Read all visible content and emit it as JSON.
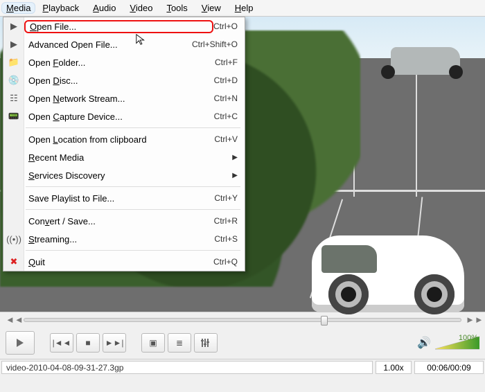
{
  "menubar": {
    "items": [
      "Media",
      "Playback",
      "Audio",
      "Video",
      "Tools",
      "View",
      "Help"
    ],
    "ul": [
      "M",
      "P",
      "A",
      "V",
      "T",
      "V",
      "H"
    ]
  },
  "dropdown": [
    {
      "icon": "▶",
      "label": "Open File...",
      "ul": "O",
      "sc": "Ctrl+O",
      "hl": true
    },
    {
      "icon": "▶",
      "label": "Advanced Open File...",
      "sc": "Ctrl+Shift+O"
    },
    {
      "icon": "📁",
      "label": "Open Folder...",
      "ul": "F",
      "sc": "Ctrl+F"
    },
    {
      "icon": "💿",
      "label": "Open Disc...",
      "ul": "D",
      "sc": "Ctrl+D"
    },
    {
      "icon": "☷",
      "label": "Open Network Stream...",
      "ul": "N",
      "sc": "Ctrl+N"
    },
    {
      "icon": "📟",
      "label": "Open Capture Device...",
      "ul": "C",
      "sc": "Ctrl+C"
    },
    {
      "sep": true
    },
    {
      "label": "Open Location from clipboard",
      "ul": "L",
      "sc": "Ctrl+V"
    },
    {
      "label": "Recent Media",
      "ul": "R",
      "sub": true
    },
    {
      "label": "Services Discovery",
      "ul": "S",
      "sub": true
    },
    {
      "sep": true
    },
    {
      "label": "Save Playlist to File...",
      "sc": "Ctrl+Y"
    },
    {
      "sep": true
    },
    {
      "label": "Convert / Save...",
      "ul": "v",
      "sc": "Ctrl+R"
    },
    {
      "icon": "((•))",
      "label": "Streaming...",
      "ul": "S",
      "sc": "Ctrl+S"
    },
    {
      "sep": true
    },
    {
      "icon": "✖",
      "iconColor": "#d22",
      "label": "Quit",
      "ul": "Q",
      "sc": "Ctrl+Q"
    }
  ],
  "seek": {
    "position_pct": 68
  },
  "volume": {
    "percent_label": "100%"
  },
  "status": {
    "filename": "video-2010-04-08-09-31-27.3gp",
    "speed": "1.00x",
    "time": "00:06/00:09"
  }
}
